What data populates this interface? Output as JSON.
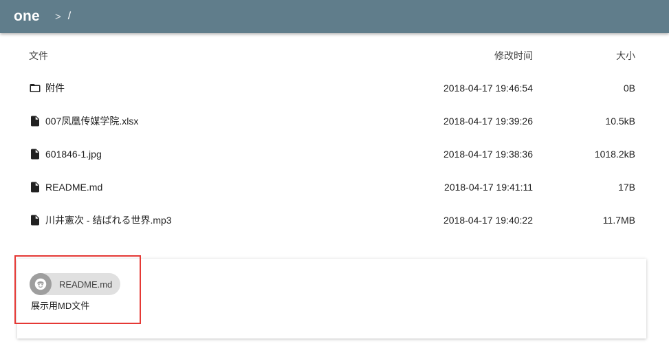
{
  "header": {
    "title": "one",
    "separator": ">",
    "path": "/",
    "background_color": "#607d8b"
  },
  "table": {
    "columns": {
      "name": "文件",
      "modified": "修改时间",
      "size": "大小"
    },
    "rows": [
      {
        "icon": "folder-icon",
        "name": "附件",
        "modified": "2018-04-17 19:46:54",
        "size": "0B"
      },
      {
        "icon": "file-icon",
        "name": "007凤凰传媒学院.xlsx",
        "modified": "2018-04-17 19:39:26",
        "size": "10.5kB"
      },
      {
        "icon": "file-icon",
        "name": "601846-1.jpg",
        "modified": "2018-04-17 19:38:36",
        "size": "1018.2kB"
      },
      {
        "icon": "file-icon",
        "name": "README.md",
        "modified": "2018-04-17 19:41:11",
        "size": "17B"
      },
      {
        "icon": "file-icon",
        "name": "川井憲次 - 结ばれる世界.mp3",
        "modified": "2018-04-17 19:40:22",
        "size": "11.7MB"
      }
    ]
  },
  "readme": {
    "chip_icon": "smiley-face-icon",
    "chip_label": "README.md",
    "content": "展示用MD文件",
    "highlight_color": "#e53935"
  }
}
